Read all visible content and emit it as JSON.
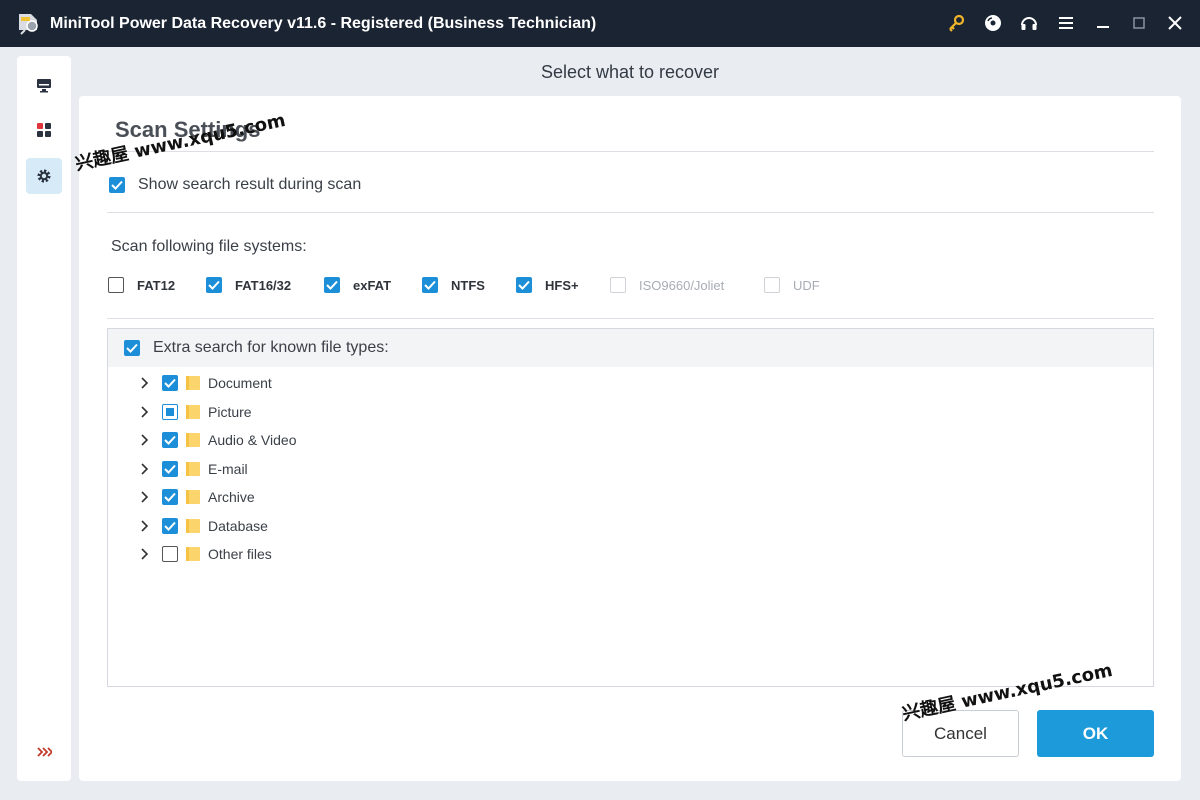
{
  "window": {
    "title": "MiniTool Power Data Recovery v11.6 - Registered (Business Technician)"
  },
  "titlebar_icons": [
    "key-icon",
    "disc-icon",
    "headphones-icon",
    "menu-icon",
    "minimize-icon",
    "maximize-icon",
    "close-icon"
  ],
  "sidebar": {
    "items": [
      {
        "icon": "computer-icon",
        "active": false
      },
      {
        "icon": "grid-icon",
        "active": false
      },
      {
        "icon": "gear-icon",
        "active": true
      }
    ],
    "expand_icon": "expand-arrows-icon"
  },
  "header": {
    "title": "Select what to recover"
  },
  "settings": {
    "title": "Scan Settings",
    "show_result": {
      "label": "Show search result during scan",
      "checked": true
    },
    "fs_heading": "Scan following file systems:",
    "file_systems": [
      {
        "label": "FAT12",
        "checked": false,
        "disabled": false
      },
      {
        "label": "FAT16/32",
        "checked": true,
        "disabled": false
      },
      {
        "label": "exFAT",
        "checked": true,
        "disabled": false
      },
      {
        "label": "NTFS",
        "checked": true,
        "disabled": false
      },
      {
        "label": "HFS+",
        "checked": true,
        "disabled": false
      },
      {
        "label": "ISO9660/Joliet",
        "checked": false,
        "disabled": true
      },
      {
        "label": "UDF",
        "checked": false,
        "disabled": true
      }
    ],
    "extra_search": {
      "label": "Extra search for known file types:",
      "checked": true
    },
    "file_types": [
      {
        "label": "Document",
        "state": "checked"
      },
      {
        "label": "Picture",
        "state": "partial"
      },
      {
        "label": "Audio & Video",
        "state": "checked"
      },
      {
        "label": "E-mail",
        "state": "checked"
      },
      {
        "label": "Archive",
        "state": "checked"
      },
      {
        "label": "Database",
        "state": "checked"
      },
      {
        "label": "Other files",
        "state": "unchecked"
      }
    ]
  },
  "buttons": {
    "cancel": "Cancel",
    "ok": "OK"
  },
  "watermarks": [
    "兴趣屋 www.xqu5.com",
    "兴趣屋 www.xqu5.com"
  ],
  "colors": {
    "titlebar": "#1b2433",
    "accent": "#1d9ad9",
    "key": "#f0b429"
  }
}
